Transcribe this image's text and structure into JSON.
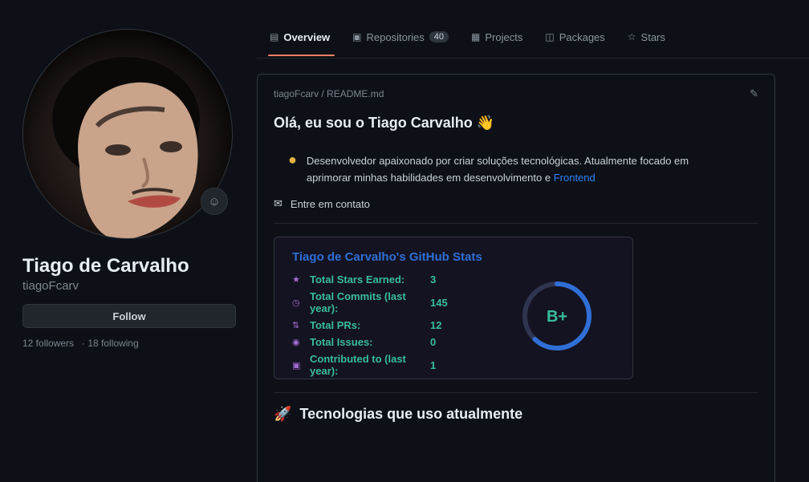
{
  "profile": {
    "name": "Tiago de Carvalho",
    "login": "tiagoFcarv",
    "follow_label": "Follow",
    "followers": "12 followers",
    "following": "· 18 following",
    "status_icon": "smile-icon"
  },
  "tabs": [
    {
      "label": "Overview",
      "icon": "book-icon",
      "count": null,
      "active": true
    },
    {
      "label": "Repositories",
      "icon": "repo-icon",
      "count": "40",
      "active": false
    },
    {
      "label": "Projects",
      "icon": "table-icon",
      "count": null,
      "active": false
    },
    {
      "label": "Packages",
      "icon": "package-icon",
      "count": null,
      "active": false
    },
    {
      "label": "Stars",
      "icon": "star-icon",
      "count": null,
      "active": false
    }
  ],
  "readme": {
    "path": "tiagoFcarv / README.md",
    "greeting": "Olá, eu sou o Tiago Carvalho 👋",
    "quote": "Desenvolvedor apaixonado por criar soluções tecnológicas. Atualmente focado em aprimorar minhas habilidades em desenvolvimento e",
    "quote_link": "Frontend",
    "mail": "Entre em contato"
  },
  "stats": {
    "title": "Tiago de Carvalho's GitHub Stats",
    "rows": [
      {
        "label": "Total Stars Earned:",
        "value": "3"
      },
      {
        "label": "Total Commits (last year):",
        "value": "145"
      },
      {
        "label": "Total PRs:",
        "value": "12"
      },
      {
        "label": "Total Issues:",
        "value": "0"
      },
      {
        "label": "Contributed to (last year):",
        "value": "1"
      }
    ],
    "rank": "B+",
    "rank_progress": 0.62
  },
  "tech": {
    "title": "Tecnologias que uso atualmente"
  },
  "colors": {
    "accent": "#f78166",
    "stat_green": "#38bd9b",
    "stat_title": "#2f6fd6",
    "link": "#2f81f7"
  }
}
